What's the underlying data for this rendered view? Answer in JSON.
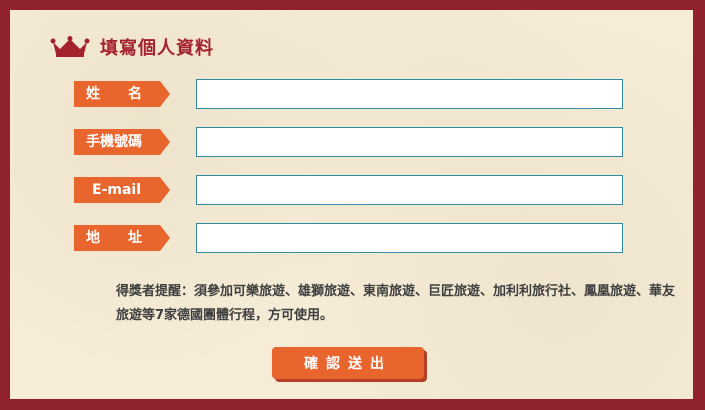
{
  "header": {
    "title": "填寫個人資料",
    "icon": "crown-icon"
  },
  "form": {
    "fields": [
      {
        "label": "姓　　名",
        "value": ""
      },
      {
        "label": "手機號碼",
        "value": ""
      },
      {
        "label": "E-mail",
        "value": ""
      },
      {
        "label": "地　　址",
        "value": ""
      }
    ]
  },
  "notice": {
    "text": "得獎者提醒：須參加可樂旅遊、雄獅旅遊、東南旅遊、巨匠旅遊、加利利旅行社、鳳凰旅遊、華友旅遊等7家德國團體行程，方可使用。"
  },
  "submit": {
    "label": "確認送出"
  },
  "colors": {
    "frame": "#8f222c",
    "panel": "#f6ecd7",
    "accent": "#e8652e",
    "title": "#a3222e",
    "input_border": "#2f8aa6"
  }
}
